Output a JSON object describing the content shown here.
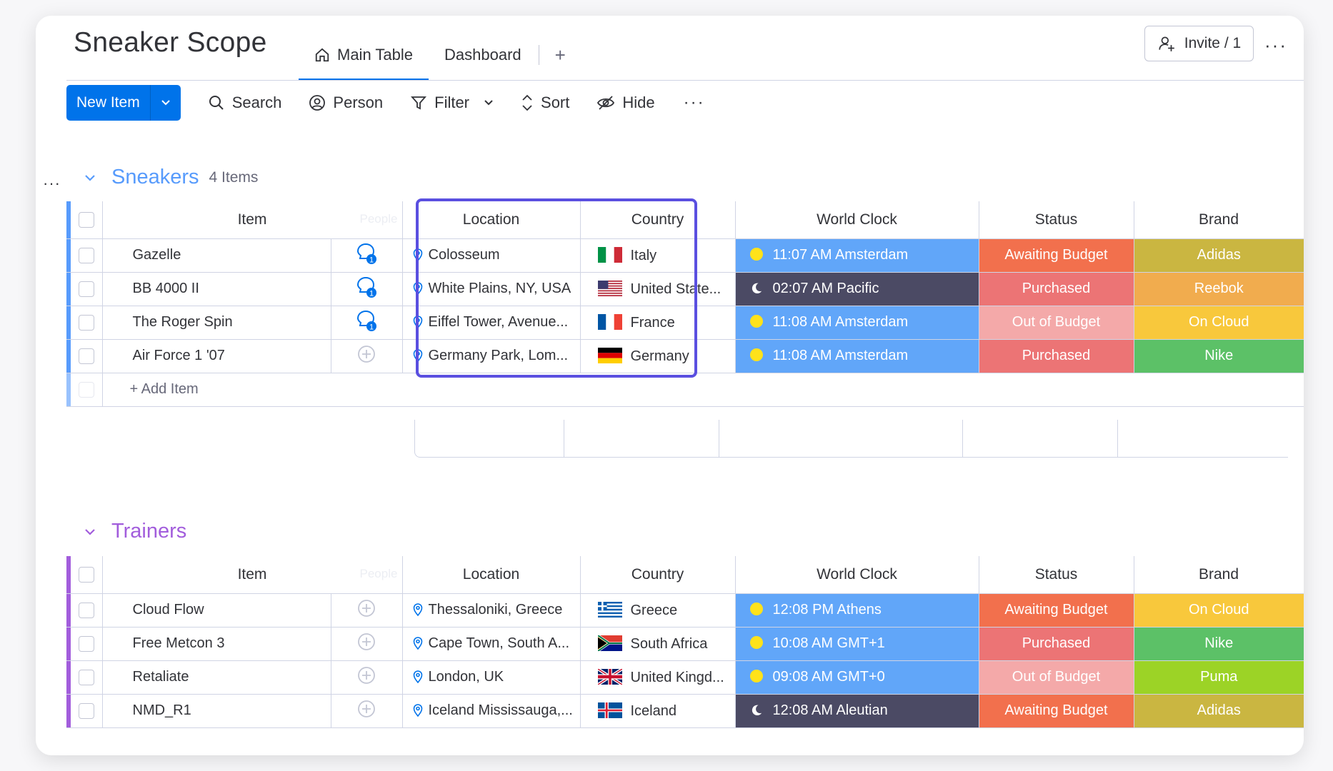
{
  "board": {
    "title": "Sneaker Scope",
    "tabs": [
      {
        "label": "Main Table",
        "active": true,
        "icon": "home-icon"
      },
      {
        "label": "Dashboard",
        "active": false
      }
    ],
    "add_tab": "+",
    "invite_label": "Invite / 1",
    "more": "···"
  },
  "toolbar": {
    "new_item": "New Item",
    "search": "Search",
    "person": "Person",
    "filter": "Filter",
    "sort": "Sort",
    "hide": "Hide",
    "more": "···"
  },
  "colors": {
    "primary": "#0073ea",
    "sneakers_group": "#579bfc",
    "trainers_group": "#a25ddc",
    "highlight": "#5a4fe0",
    "clock_day": "#61a6f9",
    "clock_night": "#4b4a64",
    "awaiting_budget": "#f2704d",
    "purchased": "#ec7475",
    "out_of_budget": "#f4a9a9",
    "adidas": "#cab641",
    "reebok": "#f1ac4e",
    "on_cloud": "#f8c83c",
    "nike": "#5cc167",
    "puma": "#9cd326"
  },
  "columns": {
    "item": "Item",
    "people_ghost": "People",
    "location": "Location",
    "country": "Country",
    "world_clock": "World Clock",
    "status": "Status",
    "brand": "Brand"
  },
  "groups": [
    {
      "name": "Sneakers",
      "count": "4 Items",
      "color": "#579bfc",
      "add_item": "+ Add Item",
      "rows": [
        {
          "item": "Gazelle",
          "person": "update-badge-icon",
          "person_count": "1",
          "location": "Colosseum",
          "country": "Italy",
          "flag": "it",
          "clock": "11:07 AM Amsterdam",
          "clock_mode": "day",
          "status": "Awaiting Budget",
          "status_color": "#f2704d",
          "brand": "Adidas",
          "brand_color": "#cab641"
        },
        {
          "item": "BB 4000 II",
          "person": "update-badge-icon",
          "person_count": "1",
          "location": "White Plains, NY, USA",
          "country": "United State...",
          "flag": "us",
          "clock": "02:07 AM Pacific",
          "clock_mode": "night",
          "status": "Purchased",
          "status_color": "#ec7475",
          "brand": "Reebok",
          "brand_color": "#f1ac4e"
        },
        {
          "item": "The Roger Spin",
          "person": "update-badge-icon",
          "person_count": "1",
          "location": "Eiffel Tower, Avenue...",
          "country": "France",
          "flag": "fr",
          "clock": "11:08 AM Amsterdam",
          "clock_mode": "day",
          "status": "Out of Budget",
          "status_color": "#f4a9a9",
          "brand": "On Cloud",
          "brand_color": "#f8c83c"
        },
        {
          "item": "Air Force 1 '07",
          "person": "add-update-icon",
          "person_count": "",
          "location": "Germany Park, Lom...",
          "country": "Germany",
          "flag": "de",
          "clock": "11:08 AM Amsterdam",
          "clock_mode": "day",
          "status": "Purchased",
          "status_color": "#ec7475",
          "brand": "Nike",
          "brand_color": "#5cc167"
        }
      ]
    },
    {
      "name": "Trainers",
      "count": "",
      "color": "#a25ddc",
      "rows": [
        {
          "item": "Cloud Flow",
          "person": "add-update-icon",
          "person_count": "",
          "location": "Thessaloniki, Greece",
          "country": "Greece",
          "flag": "gr",
          "clock": "12:08 PM Athens",
          "clock_mode": "day",
          "status": "Awaiting Budget",
          "status_color": "#f2704d",
          "brand": "On Cloud",
          "brand_color": "#f8c83c"
        },
        {
          "item": "Free Metcon 3",
          "person": "add-update-icon",
          "person_count": "",
          "location": "Cape Town, South A...",
          "country": "South Africa",
          "flag": "za",
          "clock": "10:08 AM GMT+1",
          "clock_mode": "day",
          "status": "Purchased",
          "status_color": "#ec7475",
          "brand": "Nike",
          "brand_color": "#5cc167"
        },
        {
          "item": "Retaliate",
          "person": "add-update-icon",
          "person_count": "",
          "location": "London, UK",
          "country": "United Kingd...",
          "flag": "gb",
          "clock": "09:08 AM GMT+0",
          "clock_mode": "day",
          "status": "Out of Budget",
          "status_color": "#f4a9a9",
          "brand": "Puma",
          "brand_color": "#9cd326"
        },
        {
          "item": "NMD_R1",
          "person": "add-update-icon",
          "person_count": "",
          "location": "Iceland Mississauga,...",
          "country": "Iceland",
          "flag": "is",
          "clock": "12:08 AM Aleutian",
          "clock_mode": "night",
          "status": "Awaiting Budget",
          "status_color": "#f2704d",
          "brand": "Adidas",
          "brand_color": "#cab641"
        }
      ]
    }
  ]
}
